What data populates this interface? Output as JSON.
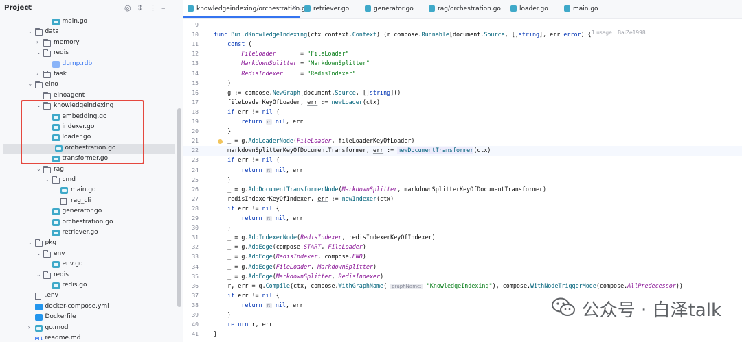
{
  "sidebar": {
    "title": "Project",
    "tree": [
      {
        "label": "main.go",
        "depth": 4,
        "kind": "go"
      },
      {
        "label": "data",
        "depth": 2,
        "kind": "folder",
        "open": true
      },
      {
        "label": "memory",
        "depth": 3,
        "kind": "folder",
        "open": false
      },
      {
        "label": "redis",
        "depth": 3,
        "kind": "folder",
        "open": true
      },
      {
        "label": "dump.rdb",
        "depth": 4,
        "kind": "rdb"
      },
      {
        "label": "task",
        "depth": 3,
        "kind": "folder",
        "open": false
      },
      {
        "label": "eino",
        "depth": 2,
        "kind": "folder",
        "open": true
      },
      {
        "label": "einoagent",
        "depth": 3,
        "kind": "folder",
        "open": null
      },
      {
        "label": "knowledgeindexing",
        "depth": 3,
        "kind": "folder",
        "open": true
      },
      {
        "label": "embedding.go",
        "depth": 4,
        "kind": "go"
      },
      {
        "label": "indexer.go",
        "depth": 4,
        "kind": "go"
      },
      {
        "label": "loader.go",
        "depth": 4,
        "kind": "go"
      },
      {
        "label": "orchestration.go",
        "depth": 4,
        "kind": "go",
        "selected": true
      },
      {
        "label": "transformer.go",
        "depth": 4,
        "kind": "go"
      },
      {
        "label": "rag",
        "depth": 3,
        "kind": "folder",
        "open": true
      },
      {
        "label": "cmd",
        "depth": 4,
        "kind": "folder",
        "open": true
      },
      {
        "label": "main.go",
        "depth": 5,
        "kind": "go"
      },
      {
        "label": "rag_cli",
        "depth": 5,
        "kind": "plain"
      },
      {
        "label": "generator.go",
        "depth": 4,
        "kind": "go"
      },
      {
        "label": "orchestration.go",
        "depth": 4,
        "kind": "go"
      },
      {
        "label": "retriever.go",
        "depth": 4,
        "kind": "go"
      },
      {
        "label": "pkg",
        "depth": 2,
        "kind": "folder",
        "open": true
      },
      {
        "label": "env",
        "depth": 3,
        "kind": "folder",
        "open": true
      },
      {
        "label": "env.go",
        "depth": 4,
        "kind": "go"
      },
      {
        "label": "redis",
        "depth": 3,
        "kind": "folder",
        "open": true
      },
      {
        "label": "redis.go",
        "depth": 4,
        "kind": "go"
      },
      {
        "label": ".env",
        "depth": 2,
        "kind": "plain"
      },
      {
        "label": "docker-compose.yml",
        "depth": 2,
        "kind": "docker"
      },
      {
        "label": "Dockerfile",
        "depth": 2,
        "kind": "docker"
      },
      {
        "label": "go.mod",
        "depth": 2,
        "kind": "go",
        "open": false
      },
      {
        "label": "readme.md",
        "depth": 2,
        "kind": "md"
      }
    ]
  },
  "tabs": [
    {
      "label": "knowledgeindexing/orchestration.go",
      "active": true
    },
    {
      "label": "retriever.go"
    },
    {
      "label": "generator.go"
    },
    {
      "label": "rag/orchestration.go"
    },
    {
      "label": "loader.go"
    },
    {
      "label": "main.go"
    }
  ],
  "editor": {
    "meta_usage": "1 usage",
    "meta_author": "BaiZe1998",
    "lines": [
      {
        "n": "9",
        "html": ""
      },
      {
        "n": "10",
        "html": "<span class='k'>func</span> <span class='fn'>BuildKnowledgeIndexing</span>(ctx context.<span class='t'>Context</span>) (r compose.<span class='t'>Runnable</span>[document.<span class='t'>Source</span>, []<span class='k'>string</span>], err <span class='k'>error</span>) {"
      },
      {
        "n": "11",
        "html": "    <span class='k'>const</span> ("
      },
      {
        "n": "12",
        "html": "        <span class='c'>FileLoader</span>       = <span class='s'>\"FileLoader\"</span>"
      },
      {
        "n": "13",
        "html": "        <span class='c'>MarkdownSplitter</span> = <span class='s'>\"MarkdownSplitter\"</span>"
      },
      {
        "n": "14",
        "html": "        <span class='c'>RedisIndexer</span>     = <span class='s'>\"RedisIndexer\"</span>"
      },
      {
        "n": "15",
        "html": "    )"
      },
      {
        "n": "16",
        "html": "    g := compose.<span class='fn'>NewGraph</span>[document.<span class='t'>Source</span>, []<span class='k'>string</span>]()"
      },
      {
        "n": "17",
        "html": "    fileLoaderKeyOfLoader, <span class='u'>err</span> := <span class='fn'>newLoader</span>(ctx)"
      },
      {
        "n": "18",
        "html": "    <span class='k'>if</span> err != <span class='k'>nil</span> {"
      },
      {
        "n": "19",
        "html": "        <span class='k'>return</span> <span class='hint'>r:</span> <span class='k'>nil</span>, err"
      },
      {
        "n": "20",
        "html": "    }"
      },
      {
        "n": "21",
        "html": "    _ = g.<span class='fn'>AddLoaderNode</span>(<span class='c'>FileLoader</span>, fileLoaderKeyOfLoader)"
      },
      {
        "n": "22",
        "html": "    markdownSplitterKeyOfDocumentTransformer, <span class='u'>err</span> := <span class='fn hl'>newDocumentTransformer</span>(ctx)"
      },
      {
        "n": "23",
        "html": "    <span class='k'>if</span> err != <span class='k'>nil</span> {"
      },
      {
        "n": "24",
        "html": "        <span class='k'>return</span> <span class='hint'>r:</span> <span class='k'>nil</span>, err"
      },
      {
        "n": "25",
        "html": "    }"
      },
      {
        "n": "26",
        "html": "    _ = g.<span class='fn'>AddDocumentTransformerNode</span>(<span class='c'>MarkdownSplitter</span>, markdownSplitterKeyOfDocumentTransformer)"
      },
      {
        "n": "27",
        "html": "    redisIndexerKeyOfIndexer, <span class='u'>err</span> := <span class='fn'>newIndexer</span>(ctx)"
      },
      {
        "n": "28",
        "html": "    <span class='k'>if</span> err != <span class='k'>nil</span> {"
      },
      {
        "n": "29",
        "html": "        <span class='k'>return</span> <span class='hint'>r:</span> <span class='k'>nil</span>, err"
      },
      {
        "n": "30",
        "html": "    }"
      },
      {
        "n": "31",
        "html": "    _ = g.<span class='fn'>AddIndexerNode</span>(<span class='c'>RedisIndexer</span>, redisIndexerKeyOfIndexer)"
      },
      {
        "n": "32",
        "html": "    _ = g.<span class='fn'>AddEdge</span>(compose.<span class='c'>START</span>, <span class='c'>FileLoader</span>)"
      },
      {
        "n": "33",
        "html": "    _ = g.<span class='fn'>AddEdge</span>(<span class='c'>RedisIndexer</span>, compose.<span class='c'>END</span>)"
      },
      {
        "n": "34",
        "html": "    _ = g.<span class='fn'>AddEdge</span>(<span class='c'>FileLoader</span>, <span class='c'>MarkdownSplitter</span>)"
      },
      {
        "n": "35",
        "html": "    _ = g.<span class='fn'>AddEdge</span>(<span class='c'>MarkdownSplitter</span>, <span class='c'>RedisIndexer</span>)"
      },
      {
        "n": "36",
        "html": "    r, err = g.<span class='fn'>Compile</span>(ctx, compose.<span class='fn'>WithGraphName</span>( <span class='hint'>graphName:</span> <span class='s'>\"KnowledgeIndexing\"</span>), compose.<span class='fn'>WithNodeTriggerMode</span>(compose.<span class='c'>AllPredecessor</span>))"
      },
      {
        "n": "37",
        "html": "    <span class='k'>if</span> err != <span class='k'>nil</span> {"
      },
      {
        "n": "38",
        "html": "        <span class='k'>return</span> <span class='hint'>r:</span> <span class='k'>nil</span>, err"
      },
      {
        "n": "39",
        "html": "    }"
      },
      {
        "n": "40",
        "html": "    <span class='k'>return</span> r, err"
      },
      {
        "n": "41",
        "html": "}"
      }
    ]
  },
  "watermark": {
    "text": "公众号 · 白泽talk",
    "icon": "wechat-icon"
  },
  "icons": {
    "target": "target-icon",
    "expand": "expand-icon",
    "more": "more-icon",
    "minimize": "minimize-icon",
    "close": "close-icon"
  }
}
